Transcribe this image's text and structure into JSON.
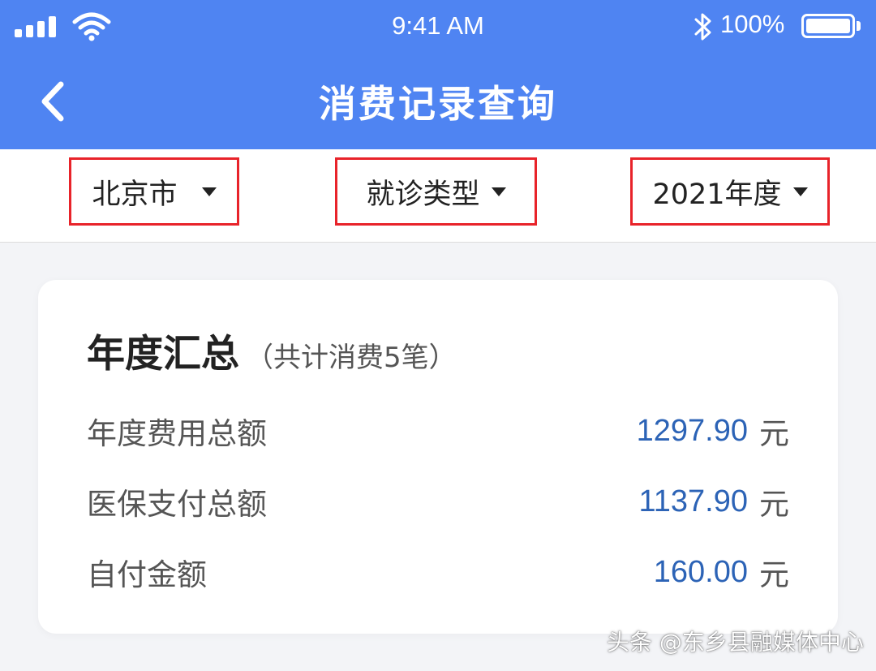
{
  "status_bar": {
    "time": "9:41 AM",
    "battery_percent": "100%",
    "battery_level": 1.0,
    "icons": [
      "signal-icon",
      "wifi-icon",
      "bluetooth-icon",
      "battery-icon"
    ]
  },
  "header": {
    "title": "消费记录查询",
    "back_icon": "chevron-left-icon",
    "background_color": "#4f84f2"
  },
  "filters": [
    {
      "label": "北京市",
      "icon": "caret-down-icon"
    },
    {
      "label": "就诊类型",
      "icon": "caret-down-icon"
    },
    {
      "label": "2021年度",
      "icon": "caret-down-icon"
    }
  ],
  "summary": {
    "title": "年度汇总",
    "subtitle": "（共计消费5笔）",
    "rows": [
      {
        "label": "年度费用总额",
        "value": "1297.90",
        "unit": "元"
      },
      {
        "label": "医保支付总额",
        "value": "1137.90",
        "unit": "元"
      },
      {
        "label": "自付金额",
        "value": "160.00",
        "unit": "元"
      }
    ],
    "value_color": "#2c63b6"
  },
  "highlight_color": "#e8232a",
  "watermark": "头条 @东乡县融媒体中心"
}
